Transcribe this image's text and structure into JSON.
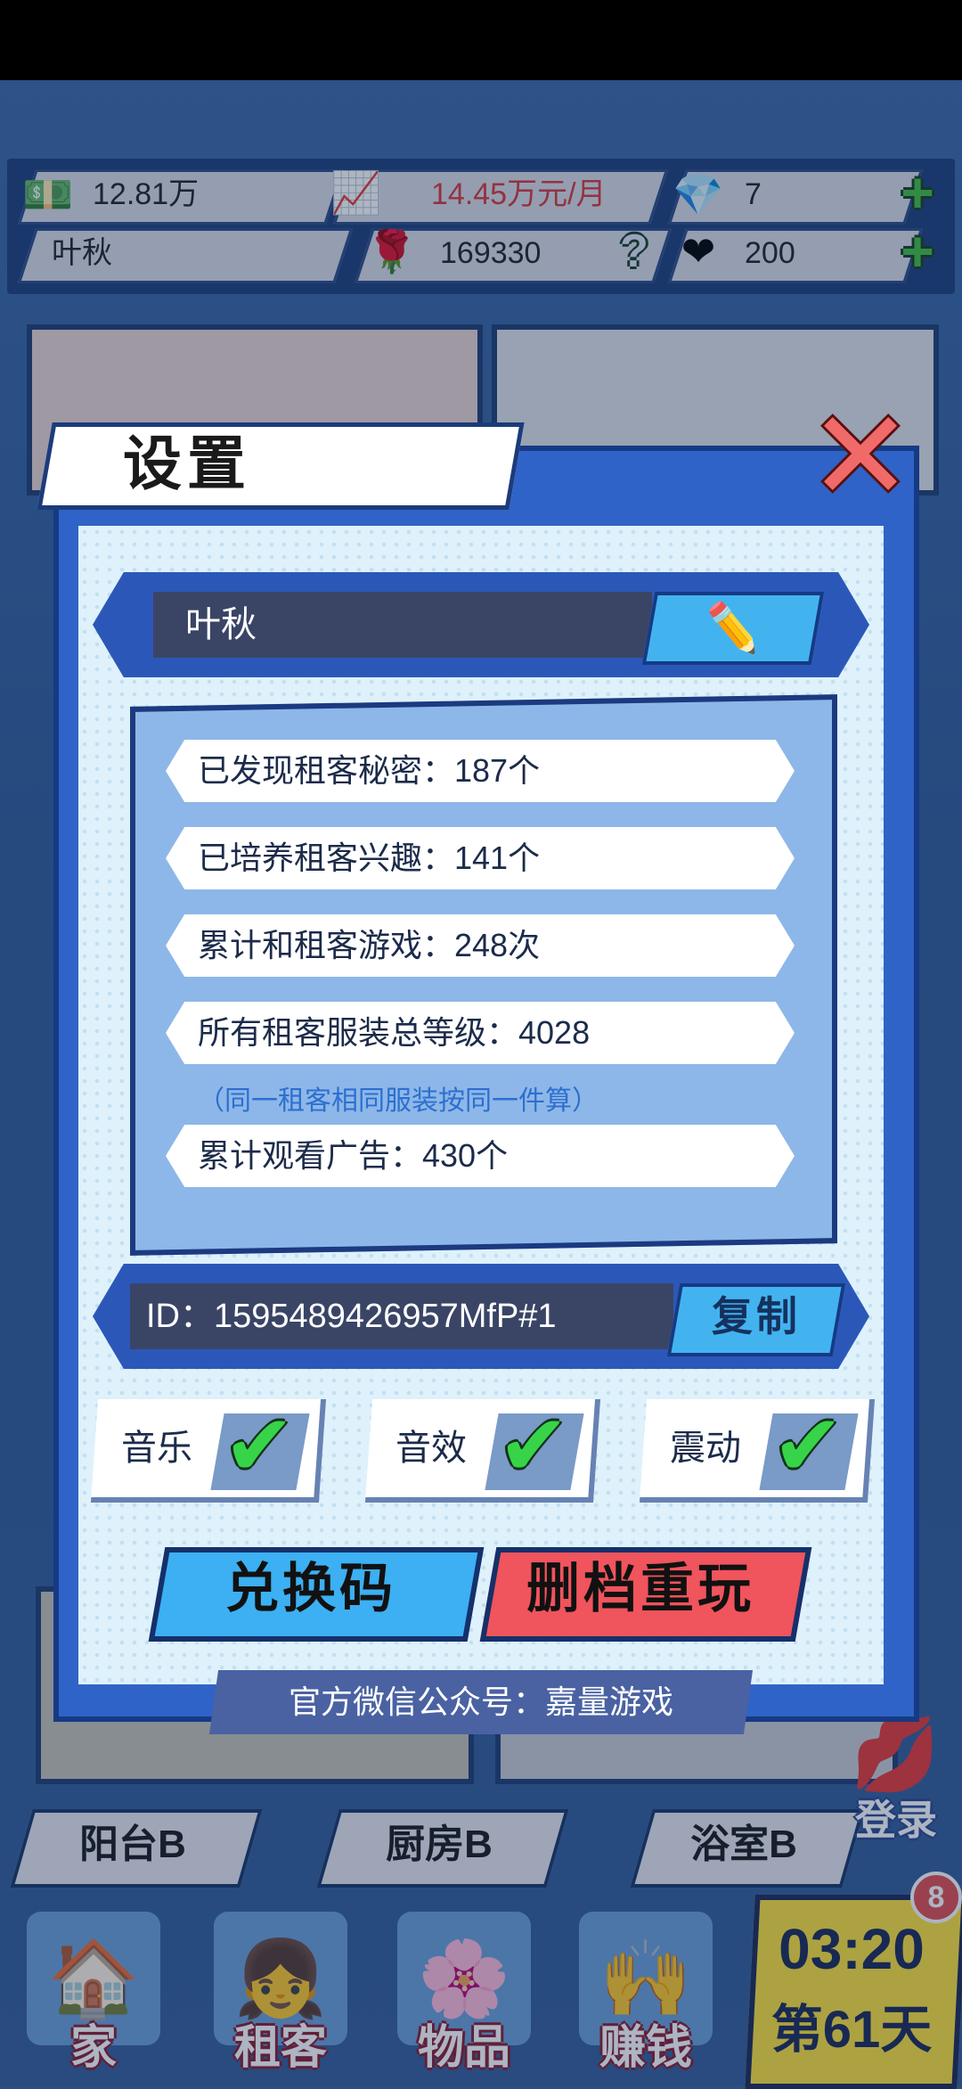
{
  "topbar": {
    "money": "12.81万",
    "income": "14.45万元/月",
    "gems": "7",
    "player_name": "叶秋",
    "rose_points": "169330",
    "hearts": "200"
  },
  "dialog": {
    "title": "设置",
    "player_name": "叶秋",
    "stats": [
      "已发现租客秘密：187个",
      "已培养租客兴趣：141个",
      "累计和租客游戏：248次",
      "所有租客服装总等级：4028",
      "累计观看广告：430个"
    ],
    "note": "（同一租客相同服装按同一件算）",
    "id_text": "ID：1595489426957MfP#1",
    "copy_label": "复制",
    "toggles": [
      "音乐",
      "音效",
      "震动"
    ],
    "redeem_label": "兑换码",
    "reset_label": "删档重玩",
    "footer": "官方微信公众号：嘉量游戏"
  },
  "rooms": [
    "阳台B",
    "厨房B",
    "浴室B"
  ],
  "nav": [
    "家",
    "租客",
    "物品",
    "赚钱"
  ],
  "clock": {
    "time": "03:20",
    "day": "第61天",
    "badge": "8"
  },
  "login_label": "登录",
  "colors": {
    "income_red": "#d63a3a",
    "check_green": "#37d44a",
    "accent_blue": "#43b3f0",
    "reset_red": "#f0545c"
  }
}
